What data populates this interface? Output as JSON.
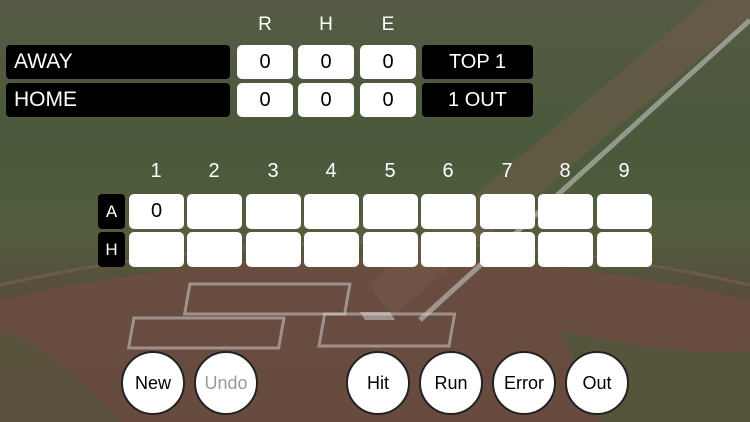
{
  "header": {
    "r": "R",
    "h": "H",
    "e": "E"
  },
  "teams": [
    {
      "name": "AWAY",
      "runs": "0",
      "hits": "0",
      "errors": "0"
    },
    {
      "name": "HOME",
      "runs": "0",
      "hits": "0",
      "errors": "0"
    }
  ],
  "status": {
    "inning": "TOP 1",
    "outs": "1 OUT"
  },
  "innings": [
    "1",
    "2",
    "3",
    "4",
    "5",
    "6",
    "7",
    "8",
    "9"
  ],
  "linescore": {
    "away_label": "A",
    "home_label": "H",
    "away": [
      "0",
      "",
      "",
      "",
      "",
      "",
      "",
      "",
      ""
    ],
    "home": [
      "",
      "",
      "",
      "",
      "",
      "",
      "",
      "",
      ""
    ]
  },
  "buttons": {
    "new": "New",
    "undo": "Undo",
    "hit": "Hit",
    "run": "Run",
    "error": "Error",
    "out": "Out"
  },
  "colors": {
    "panel": "#000000",
    "cell": "#ffffff",
    "disabled_text": "#9a9a9a"
  }
}
